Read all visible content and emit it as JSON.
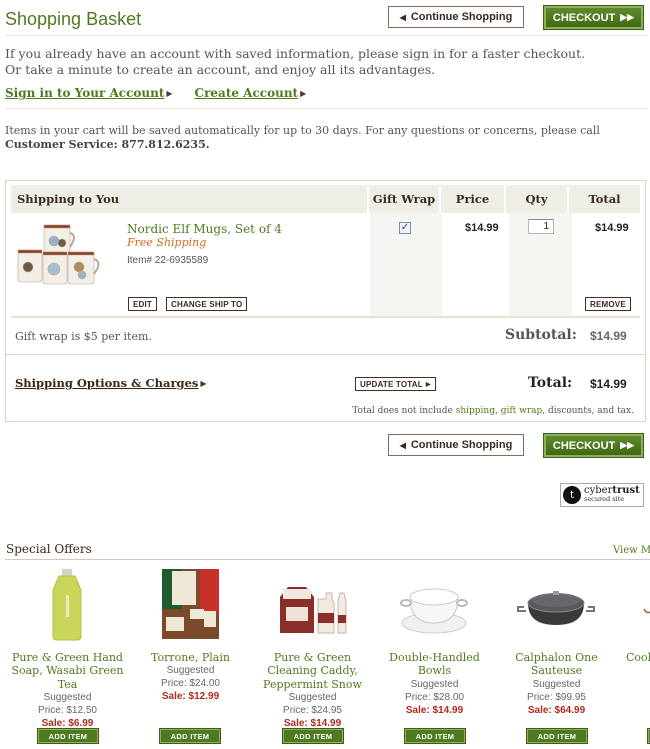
{
  "header": {
    "title": "Shopping Basket",
    "continue_label": "Continue Shopping",
    "checkout_label": "CHECKOUT"
  },
  "intro": {
    "line1": "If you already have an account with saved information, please sign in for a faster checkout.",
    "line2": "Or take a minute to create an account, and enjoy all its advantages.",
    "sign_in_link": "Sign in to Your Account",
    "create_account_link": "Create Account"
  },
  "notice": {
    "text": "Items in your cart will be saved automatically for up to 30 days. For any questions or concerns, please call",
    "service": "Customer Service: 877.812.6235."
  },
  "cart": {
    "columns": [
      "Shipping to You",
      "Gift Wrap",
      "Price",
      "Qty",
      "Total"
    ],
    "items": [
      {
        "name": "Nordic Elf Mugs, Set of 4",
        "shipping": "Free Shipping",
        "item_number": "Item# 22-6935589",
        "gift_wrap": true,
        "price": "$14.99",
        "qty": "1",
        "total": "$14.99",
        "edit_label": "EDIT",
        "change_ship_label": "CHANGE SHIP TO",
        "remove_label": "REMOVE"
      }
    ],
    "gift_wrap_note": "Gift wrap is $5 per item.",
    "subtotal_label": "Subtotal:",
    "subtotal": "$14.99",
    "shipping_link": "Shipping Options & Charges",
    "update_total_label": "UPDATE TOTAL",
    "total_label": "Total:",
    "total": "$14.99",
    "total_note": {
      "pre": "Total does not include",
      "shipping": "shipping",
      "gift_wrap": "gift wrap",
      "post": ", discounts, and tax."
    }
  },
  "badge": {
    "line1_a": "cyber",
    "line1_b": "trust",
    "line2": "secured site",
    "logo_letter": "t"
  },
  "special_offers": {
    "title": "Special Offers",
    "view_more": "View More",
    "add_label": "ADD ITEM",
    "items": [
      {
        "name": "Pure & Green Hand Soap, Wasabi Green Tea",
        "suggested": "Suggested",
        "price": "Price: $12.50",
        "sale": "Sale: $6.99"
      },
      {
        "name": "Torrone, Plain",
        "suggested": "Suggested",
        "price": "Price: $24.00",
        "sale": "Sale: $12.99"
      },
      {
        "name": "Pure & Green Cleaning Caddy, Peppermint Snow",
        "suggested": "Suggested",
        "price": "Price: $24.95",
        "sale": "Sale: $14.99"
      },
      {
        "name": "Double-Handled Bowls",
        "suggested": "Suggested",
        "price": "Price: $28.00",
        "sale": "Sale: $14.99"
      },
      {
        "name": "Calphalon One Sauteuse",
        "suggested": "Suggested",
        "price": "Price: $99.95",
        "sale": "Sale: $64.99"
      },
      {
        "name": "Cook",
        "suggested": "",
        "price": "",
        "sale": ""
      }
    ]
  }
}
